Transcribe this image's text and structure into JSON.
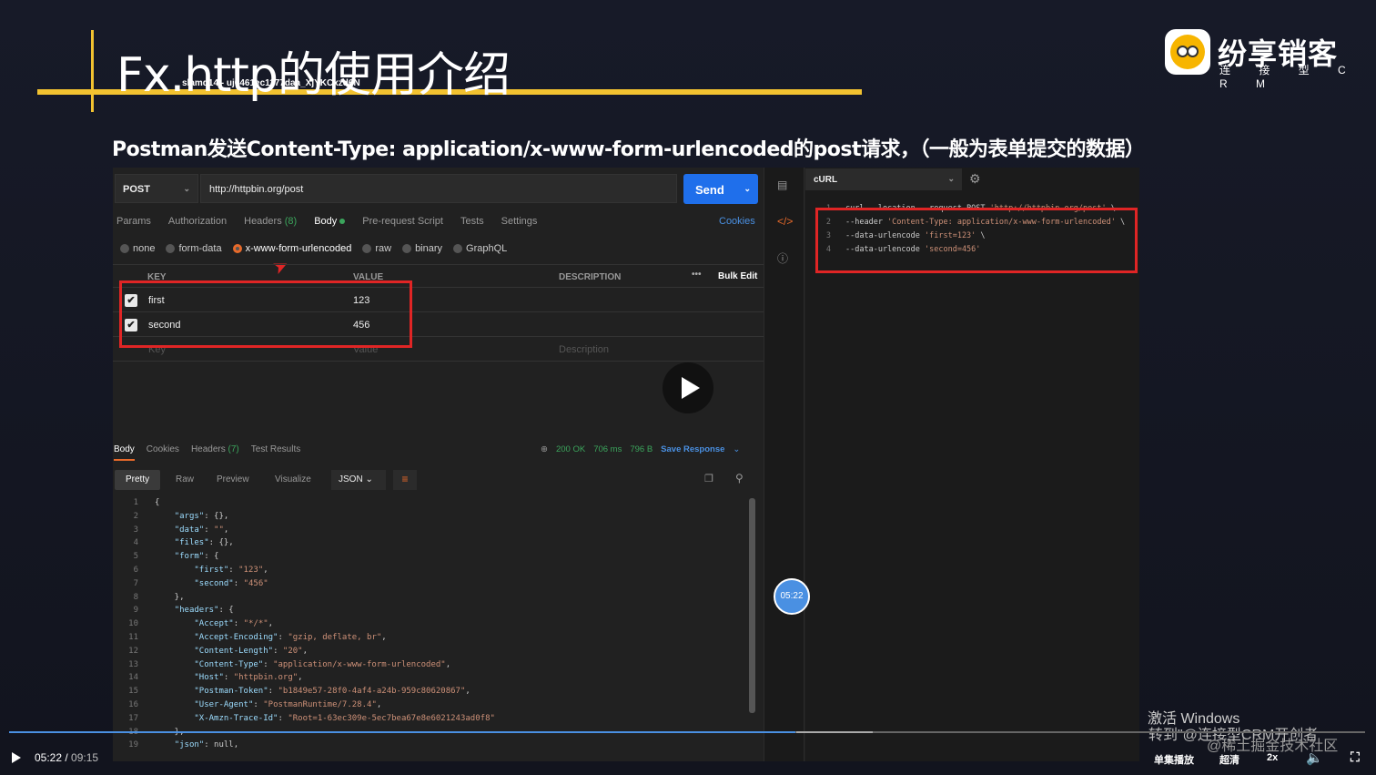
{
  "slide": {
    "title": "Fx.http的使用介绍",
    "watermark_id": "slamd14 - uj6461ec1177daa_XjYKCxzd6N",
    "brand_name": "纷享销客",
    "brand_sub": "连 接 型 C R M",
    "subtitle": "Postman发送Content-Type: application/x-www-form-urlencoded的post请求，（一般为表单提交的数据）"
  },
  "request": {
    "method": "POST",
    "url": "http://httpbin.org/post",
    "send_label": "Send",
    "tabs": [
      "Params",
      "Authorization",
      "Headers",
      "Body",
      "Pre-request Script",
      "Tests",
      "Settings"
    ],
    "headers_count": "(8)",
    "cookies_label": "Cookies",
    "body_types": [
      "none",
      "form-data",
      "x-www-form-urlencoded",
      "raw",
      "binary",
      "GraphQL"
    ],
    "table_headers": {
      "key": "KEY",
      "value": "VALUE",
      "description": "DESCRIPTION",
      "more": "•••",
      "bulk_edit": "Bulk Edit"
    },
    "rows": [
      {
        "key": "first",
        "value": "123",
        "checked": "✔"
      },
      {
        "key": "second",
        "value": "456",
        "checked": "✔"
      }
    ],
    "placeholder": {
      "key": "Key",
      "value": "Value",
      "description": "Description"
    }
  },
  "response": {
    "tabs": [
      "Body",
      "Cookies",
      "Headers",
      "Test Results"
    ],
    "headers_count": "(7)",
    "status": "200 OK",
    "time": "706 ms",
    "size": "796 B",
    "save_label": "Save Response",
    "view_tabs": [
      "Pretty",
      "Raw",
      "Preview",
      "Visualize"
    ],
    "format": "JSON",
    "code_lines": [
      "{",
      "    \"args\": {},",
      "    \"data\": \"\",",
      "    \"files\": {},",
      "    \"form\": {",
      "        \"first\": \"123\",",
      "        \"second\": \"456\"",
      "    },",
      "    \"headers\": {",
      "        \"Accept\": \"*/*\",",
      "        \"Accept-Encoding\": \"gzip, deflate, br\",",
      "        \"Content-Length\": \"20\",",
      "        \"Content-Type\": \"application/x-www-form-urlencoded\",",
      "        \"Host\": \"httpbin.org\",",
      "        \"Postman-Token\": \"b1849e57-28f0-4af4-a24b-959c80620867\",",
      "        \"User-Agent\": \"PostmanRuntime/7.28.4\",",
      "        \"X-Amzn-Trace-Id\": \"Root=1-63ec309e-5ec7bea67e8e6021243ad0f8\"",
      "    },",
      "    \"json\": null,"
    ]
  },
  "snippet": {
    "language": "cURL",
    "lines": [
      "curl --location --request POST 'http://httpbin.org/post' \\",
      "--header 'Content-Type: application/x-www-form-urlencoded' \\",
      "--data-urlencode 'first=123' \\",
      "--data-urlencode 'second=456'"
    ]
  },
  "player": {
    "current": "05:22",
    "total": "09:15",
    "bubble_time": "05:22",
    "progress": 0.58,
    "controls": [
      "单集播放",
      "超清",
      "2x"
    ]
  },
  "overlays": {
    "windows_activate": "激活 Windows",
    "windows_sub": "转到\"@连接型CRM开创者",
    "juejin": "@稀土掘金技术社区"
  },
  "colors": {
    "accent": "#f2c230",
    "send": "#1f6feb",
    "highlight": "#e02525",
    "active_tab": "#e86a2a"
  }
}
